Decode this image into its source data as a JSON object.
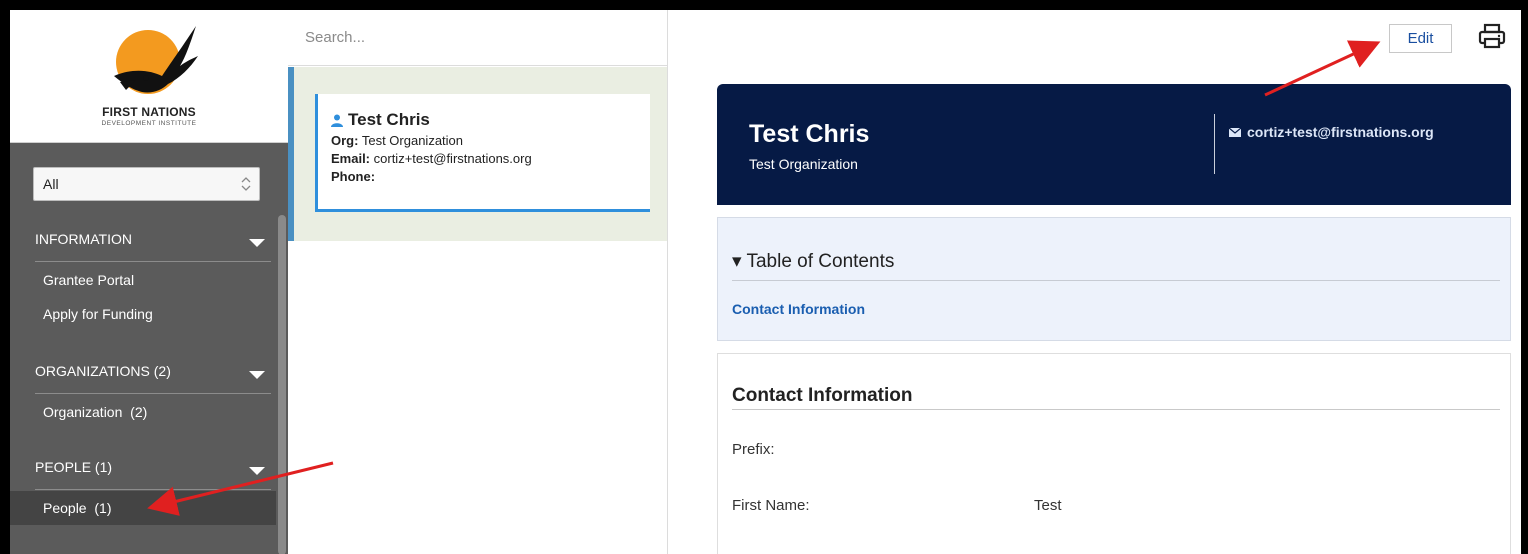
{
  "brand": {
    "title": "FIRST NATIONS",
    "subtitle": "DEVELOPMENT INSTITUTE",
    "sun_color": "#f39a1f",
    "eagle_color": "#111111"
  },
  "sidebar": {
    "filter": {
      "selected": "All"
    },
    "sections": [
      {
        "label": "INFORMATION",
        "items": [
          {
            "label": "Grantee Portal"
          },
          {
            "label": "Apply for Funding"
          }
        ]
      },
      {
        "label": "ORGANIZATIONS (2)",
        "items": [
          {
            "label": "Organization  (2)"
          }
        ]
      },
      {
        "label": "PEOPLE (1)",
        "items": [
          {
            "label": "People  (1)",
            "active": true
          }
        ]
      }
    ]
  },
  "list": {
    "search_placeholder": "Search...",
    "card": {
      "name": "Test Chris",
      "org_label": "Org:",
      "org_value": "Test Organization",
      "email_label": "Email:",
      "email_value": "cortiz+test@firstnations.org",
      "phone_label": "Phone:",
      "phone_value": ""
    }
  },
  "detail": {
    "edit_label": "Edit",
    "header": {
      "name": "Test Chris",
      "org": "Test Organization",
      "email": "cortiz+test@firstnations.org",
      "bg_color": "#061a45"
    },
    "toc": {
      "title": "▾ Table of Contents",
      "link": "Contact Information"
    },
    "contact": {
      "title": "Contact Information",
      "fields": [
        {
          "label": "Prefix:",
          "value": ""
        },
        {
          "label": "First Name:",
          "value": "Test"
        }
      ]
    }
  },
  "annotations": {
    "arrow_color": "#e02020"
  }
}
